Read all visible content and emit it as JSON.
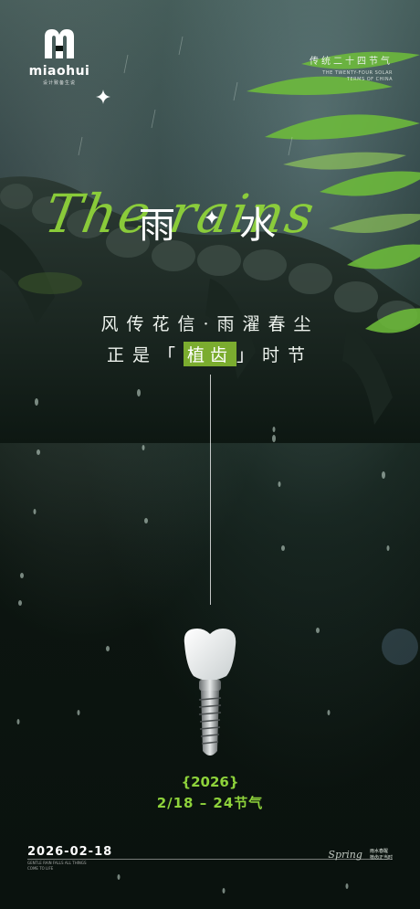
{
  "brand": {
    "name": "miaohui",
    "tagline": "设计致备生说"
  },
  "header": {
    "title": "传统二十四节气",
    "subtitle": "THE TWENTY-FOUR SOLAR TERMS OF CHINA"
  },
  "term": {
    "char1": "雨",
    "char2": "水",
    "script": "The rains"
  },
  "verse": {
    "line1": "风传花信·雨濯春尘",
    "line2_before": "正是",
    "line2_open": "「",
    "line2_highlight": "植齿",
    "line2_close": "」",
    "line2_after": "时节"
  },
  "event": {
    "year": "{2026}",
    "dates": "2/18 – 24节气"
  },
  "footer": {
    "date": "2026-02-18",
    "note": "GENTLE RAIN FALLS ALL THINGS COME TO LIFE",
    "script": "Spring",
    "text_line1": "雨水春醒",
    "text_line2": "植齿正当时"
  },
  "colors": {
    "accent": "#8ed23b",
    "text": "#eef3ee",
    "background": "#0b1410"
  }
}
